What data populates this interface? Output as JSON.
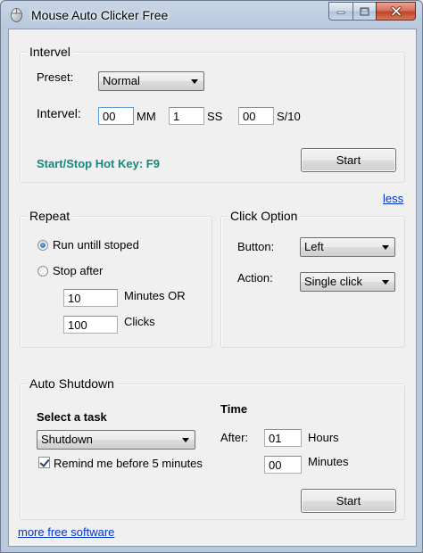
{
  "window": {
    "title": "Mouse Auto Clicker Free",
    "icon": "mouse-cursor-icon"
  },
  "interval": {
    "title": "Intervel",
    "preset_label": "Preset:",
    "preset_value": "Normal",
    "interval_label": "Intervel:",
    "mm_value": "00",
    "mm_unit": "MM",
    "ss_value": "1",
    "ss_unit": "SS",
    "s10_value": "00",
    "s10_unit": "S/10",
    "hotkey_text": "Start/Stop Hot Key: F9",
    "start_label": "Start",
    "hotkey_color": "#118a7e"
  },
  "less_link": "less",
  "repeat": {
    "title": "Repeat",
    "run_until_label": "Run untill stoped",
    "stop_after_label": "Stop after",
    "minutes_value": "10",
    "minutes_label": "Minutes OR",
    "clicks_value": "100",
    "clicks_label": "Clicks"
  },
  "click_option": {
    "title": "Click Option",
    "button_label": "Button:",
    "button_value": "Left",
    "action_label": "Action:",
    "action_value": "Single click"
  },
  "auto_shutdown": {
    "title": "Auto Shutdown",
    "select_task_label": "Select a task",
    "task_value": "Shutdown",
    "remind_label": "Remind me before 5 minutes",
    "time_label": "Time",
    "after_label": "After:",
    "hours_value": "01",
    "hours_label": "Hours",
    "minutes_value": "00",
    "minutes_label": "Minutes",
    "start_label": "Start"
  },
  "footer_link": "more free software",
  "colors": {
    "link": "#0033cc",
    "accent": "#118a7e"
  }
}
